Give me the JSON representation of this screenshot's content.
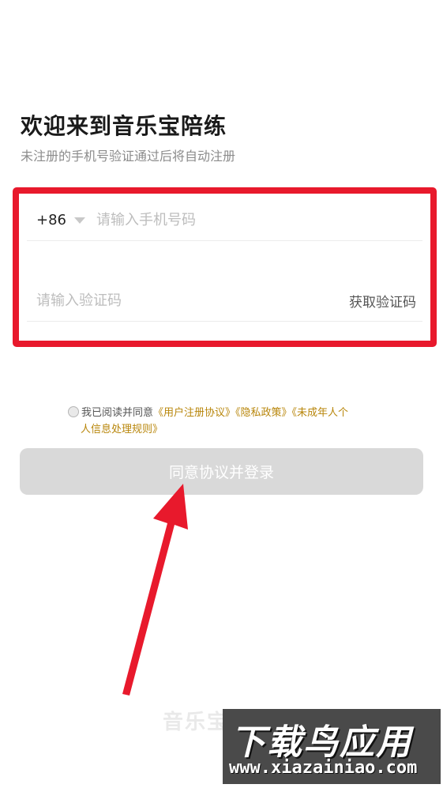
{
  "header": {
    "title": "欢迎来到音乐宝陪练",
    "subtitle": "未注册的手机号验证通过后将自动注册"
  },
  "form": {
    "country_code": "+86",
    "phone_placeholder": "请输入手机号码",
    "phone_value": "",
    "code_placeholder": "请输入验证码",
    "code_value": "",
    "get_code_label": "获取验证码"
  },
  "agreement": {
    "checked": false,
    "prefix": "我已阅读并同意",
    "link_user": "《用户注册协议》",
    "link_privacy": "《隐私政策》",
    "link_minor_1": "《未成年人个",
    "link_minor_2": "人信息处理规则》"
  },
  "login_button_label": "同意协议并登录",
  "footer_brand": "音乐宝",
  "watermark": {
    "top": "下载鸟应用",
    "bottom": "www.xiazainiao.com"
  },
  "colors": {
    "highlight_red": "#e8192c",
    "link_gold": "#b8860b",
    "button_disabled": "#d9d9d9"
  }
}
